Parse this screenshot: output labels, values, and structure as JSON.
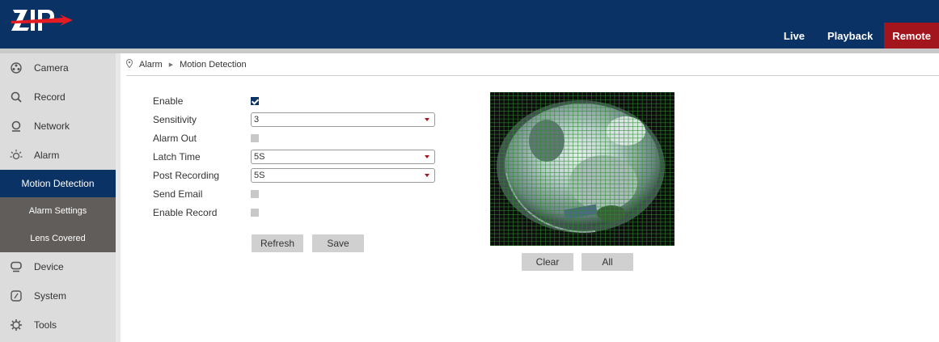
{
  "header": {
    "logo_text": "ZIP",
    "nav": [
      {
        "label": "Live",
        "active": false
      },
      {
        "label": "Playback",
        "active": false
      },
      {
        "label": "Remote",
        "active": true
      }
    ]
  },
  "sidebar": {
    "items": [
      {
        "label": "Camera",
        "icon": "camera-icon"
      },
      {
        "label": "Record",
        "icon": "record-icon"
      },
      {
        "label": "Network",
        "icon": "network-icon"
      },
      {
        "label": "Alarm",
        "icon": "alarm-icon"
      }
    ],
    "alarm_subitems": [
      {
        "label": "Motion Detection",
        "active": true
      },
      {
        "label": "Alarm Settings",
        "active": false
      },
      {
        "label": "Lens Covered",
        "active": false
      }
    ],
    "items_after": [
      {
        "label": "Device",
        "icon": "device-icon"
      },
      {
        "label": "System",
        "icon": "system-icon"
      },
      {
        "label": "Tools",
        "icon": "tools-icon"
      }
    ]
  },
  "breadcrumb": [
    "Alarm",
    "Motion Detection"
  ],
  "form": {
    "enable_label": "Enable",
    "enable_checked": true,
    "sensitivity_label": "Sensitivity",
    "sensitivity_value": "3",
    "alarm_out_label": "Alarm Out",
    "alarm_out_checked": false,
    "latch_time_label": "Latch Time",
    "latch_time_value": "5S",
    "post_recording_label": "Post Recording",
    "post_recording_value": "5S",
    "send_email_label": "Send Email",
    "send_email_checked": false,
    "enable_record_label": "Enable Record",
    "enable_record_checked": false,
    "refresh_label": "Refresh",
    "save_label": "Save"
  },
  "preview": {
    "clear_label": "Clear",
    "all_label": "All",
    "grid_color": "#2f8a2f"
  },
  "colors": {
    "header_bg": "#0b3264",
    "active_nav_bg": "#a3151d",
    "sidebar_bg": "#dcdcdc",
    "submenu_bg": "#605d5b"
  }
}
